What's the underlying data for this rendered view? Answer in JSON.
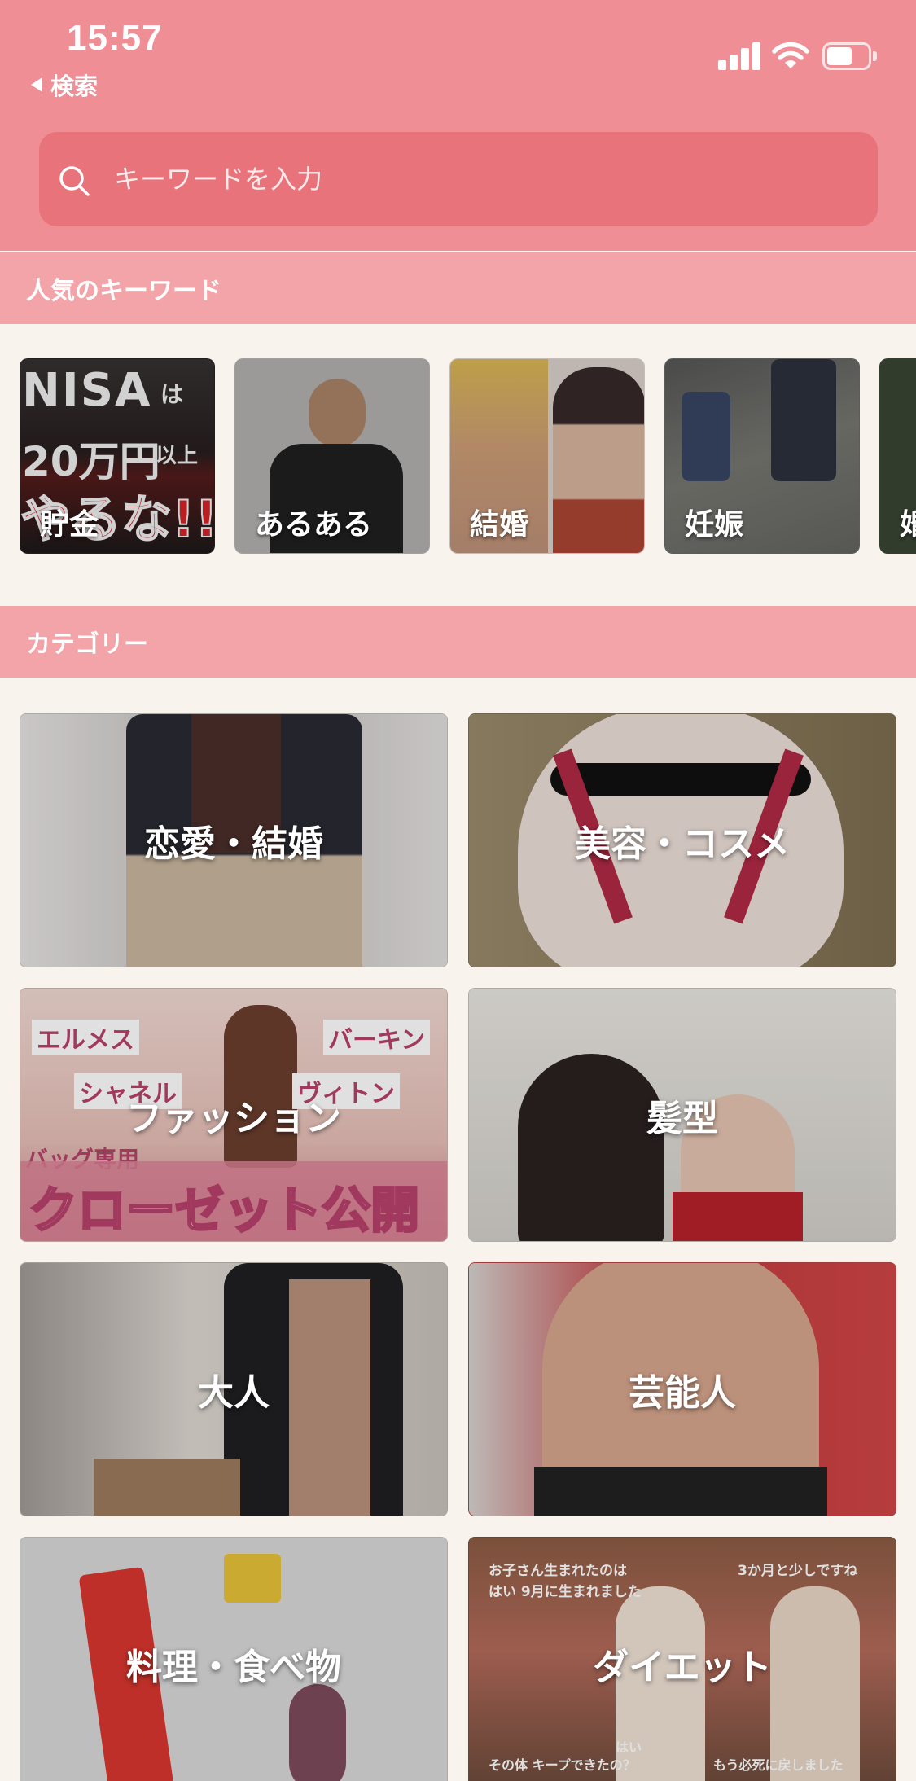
{
  "status_bar": {
    "time": "15:57",
    "back_label": "検索"
  },
  "search": {
    "placeholder": "キーワードを入力"
  },
  "sections": {
    "popular_title": "人気のキーワード",
    "category_title": "カテゴリー"
  },
  "keywords": [
    {
      "label": "貯金",
      "image_text": [
        "NISA",
        "は",
        "20万円",
        "以上",
        "やるな!!"
      ]
    },
    {
      "label": "あるある"
    },
    {
      "label": "結婚"
    },
    {
      "label": "妊娠"
    },
    {
      "label": "婚"
    }
  ],
  "categories": [
    {
      "label": "恋愛・結婚"
    },
    {
      "label": "美容・コスメ"
    },
    {
      "label": "ファッション",
      "image_text": [
        "エルメス",
        "バーキン",
        "シャネル",
        "ヴィトン",
        "バッグ専用",
        "クローゼット公開"
      ]
    },
    {
      "label": "髪型"
    },
    {
      "label": "大人"
    },
    {
      "label": "芸能人"
    },
    {
      "label": "料理・食べ物"
    },
    {
      "label": "ダイエット",
      "image_text": [
        "お子さん生まれたのは",
        "はい 9月に生まれました",
        "3か月と少しですね",
        "その体 キープできたの？",
        "もう必死に戻しました",
        "はい"
      ]
    }
  ],
  "colors": {
    "header": "#ef8e94",
    "search_box": "#e8737b",
    "section_bar": "#f3a4a8",
    "background": "#f9f3ee"
  }
}
